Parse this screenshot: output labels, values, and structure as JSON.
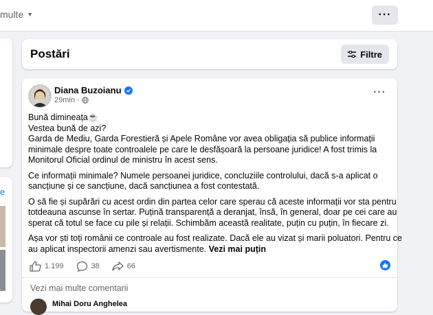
{
  "topbar": {
    "more_label": "multe"
  },
  "posts_header": {
    "title": "Postări",
    "filter_label": "Filtre"
  },
  "post": {
    "author": "Diana Buzoianu",
    "time": "29min",
    "body_lines": [
      [
        "Bună dimineața☕",
        "Vestea bună de azi?",
        "Garda de Mediu, Garda Forestieră și Apele Române vor avea obligația să publice informații",
        "minimale despre toate controalele pe care le desfășoară la persoane juridice! A fost trimis la",
        "Monitorul Oficial ordinul de ministru în acest sens."
      ],
      [
        "Ce informații minimale? Numele persoanei juridice, concluziile controlului, dacă s-a aplicat o",
        "sancțiune și ce sancțiune, dacă sancțiunea a fost contestată."
      ],
      [
        "O să fie și supărări cu acest ordin din partea celor care sperau că aceste informații vor sta pentru",
        "totdeauna ascunse în sertar. Puțină transparență a deranjat, însă, în general, doar pe cei care au",
        "sperat că totul se face cu pile și relații. Schimbăm această realitate, puțin cu puțin, în fiecare zi."
      ],
      [
        "Așa vor ști toți românii ce controale au fost realizate. Dacă ele au vizat și marii poluatori. Pentru ce",
        "au aplicat inspectorii amenzi sau avertismente."
      ]
    ],
    "see_less": "Vezi mai puțin",
    "likes": "1.199",
    "comments": "38",
    "shares": "66",
    "more_comments": "Vezi mai multe comentarii",
    "commenter": "Mihai Doru Anghelea"
  }
}
